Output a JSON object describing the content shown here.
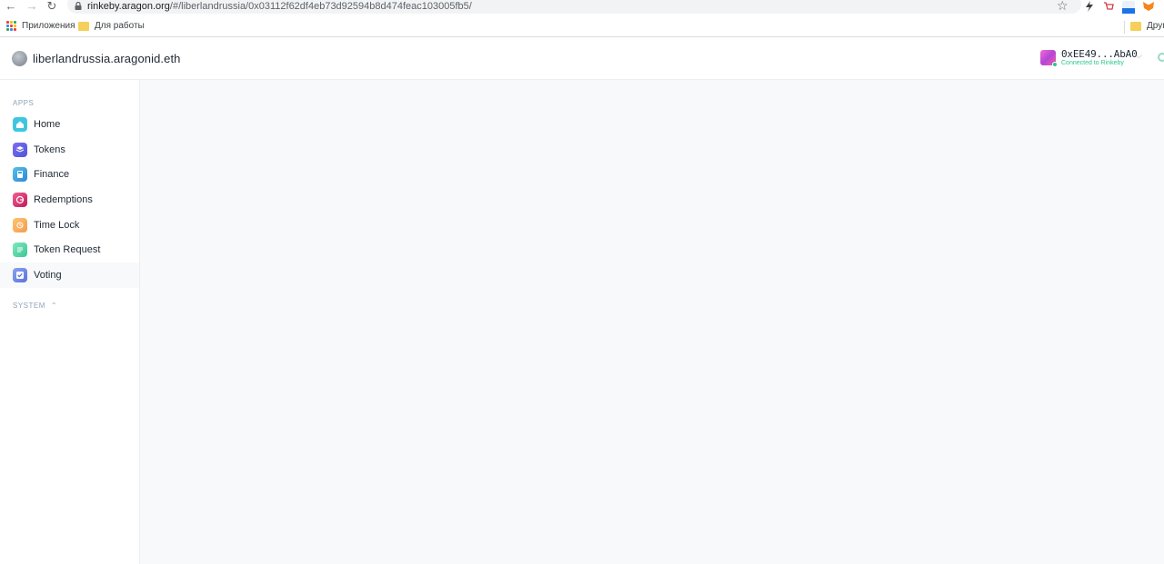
{
  "browser": {
    "url_host": "rinkeby.aragon.org",
    "url_path": "/#/liberlandrussia/0x03112f62df4eb73d92594b8d474feac103005fb5/",
    "bookmarks": [
      {
        "label": "Приложения",
        "icon": "apps-grid-icon"
      },
      {
        "label": "Для работы",
        "icon": "folder-icon"
      },
      {
        "label": "Други",
        "icon": "folder-icon"
      }
    ]
  },
  "header": {
    "org_name": "liberlandrussia.aragonid.eth",
    "account_address": "0xEE49...AbA0",
    "network_status": "Connected to Rinkeby"
  },
  "sidebar": {
    "apps_label": "APPS",
    "items": [
      {
        "label": "Home",
        "icon": "home-icon",
        "color": "#3ec6e0",
        "active": false
      },
      {
        "label": "Tokens",
        "icon": "tokens-icon",
        "color": "#6b62e8",
        "active": false
      },
      {
        "label": "Finance",
        "icon": "finance-icon",
        "color": "#3aa7e0",
        "active": false
      },
      {
        "label": "Redemptions",
        "icon": "redemptions-icon",
        "color": "#e0497d",
        "active": false
      },
      {
        "label": "Time Lock",
        "icon": "time-lock-icon",
        "color": "#f7b267",
        "active": false
      },
      {
        "label": "Token Request",
        "icon": "token-request-icon",
        "color": "#55d6a3",
        "active": false
      },
      {
        "label": "Voting",
        "icon": "voting-icon",
        "color": "#6e8ce8",
        "active": true
      }
    ],
    "system_label": "SYSTEM"
  },
  "colors": {
    "accent_green": "#2cc68f",
    "sidebar_border": "#eaeff3",
    "main_background": "#f8f9fb"
  }
}
